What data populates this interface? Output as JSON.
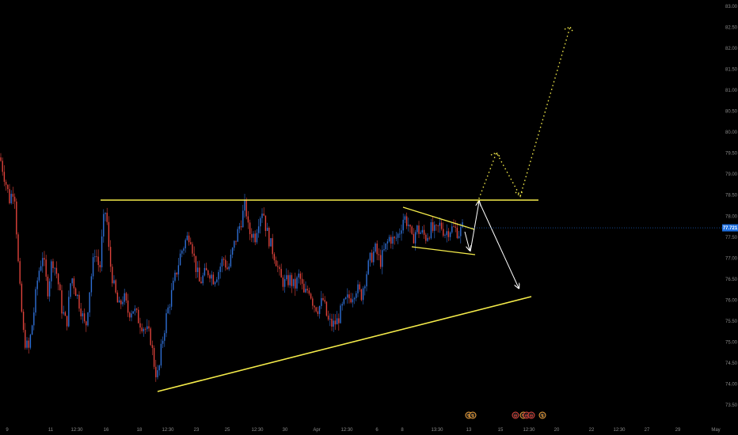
{
  "chart_data": {
    "type": "candlestick",
    "y_axis": {
      "position": "right",
      "range": [
        73.25,
        83.1
      ],
      "ticks": [
        "83.00",
        "82.50",
        "82.00",
        "81.50",
        "81.00",
        "80.50",
        "80.00",
        "79.50",
        "79.00",
        "78.50",
        "78.00",
        "77.50",
        "77.00",
        "76.50",
        "76.00",
        "75.50",
        "75.00",
        "74.50",
        "74.00",
        "73.50"
      ]
    },
    "x_axis": {
      "ticks": [
        "9",
        "11",
        "12:30",
        "16",
        "18",
        "12:30",
        "23",
        "25",
        "12:30",
        "30",
        "Apr",
        "12:30",
        "6",
        "8",
        "13:30",
        "13",
        "15",
        "12:30",
        "20",
        "22",
        "12:30",
        "27",
        "29",
        "May"
      ]
    },
    "last_price": "77.721",
    "colors": {
      "background": "#000000",
      "up_candle": "#2f6fd6",
      "down_candle": "#e0433b",
      "annotation_yellow": "#f5ec4a",
      "arrow_white": "#ffffff",
      "price_tag": "#1e6fe0"
    },
    "ohlc_path": [
      [
        0,
        79.4
      ],
      [
        5,
        79.0
      ],
      [
        12,
        78.4
      ],
      [
        18,
        78.7
      ],
      [
        24,
        76.5
      ],
      [
        30,
        75.1
      ],
      [
        36,
        74.8
      ],
      [
        42,
        75.6
      ],
      [
        48,
        76.6
      ],
      [
        54,
        77.1
      ],
      [
        60,
        76.2
      ],
      [
        66,
        77.0
      ],
      [
        72,
        76.6
      ],
      [
        78,
        75.8
      ],
      [
        84,
        75.4
      ],
      [
        90,
        76.6
      ],
      [
        96,
        76.2
      ],
      [
        102,
        75.8
      ],
      [
        108,
        75.3
      ],
      [
        114,
        76.4
      ],
      [
        120,
        77.2
      ],
      [
        126,
        76.7
      ],
      [
        130,
        77.8
      ],
      [
        134,
        78.2
      ],
      [
        138,
        77.0
      ],
      [
        144,
        76.3
      ],
      [
        150,
        75.8
      ],
      [
        156,
        76.1
      ],
      [
        162,
        75.7
      ],
      [
        168,
        75.8
      ],
      [
        176,
        75.5
      ],
      [
        184,
        75.3
      ],
      [
        190,
        75.1
      ],
      [
        196,
        74.3
      ],
      [
        200,
        74.2
      ],
      [
        204,
        74.9
      ],
      [
        210,
        75.6
      ],
      [
        216,
        76.1
      ],
      [
        222,
        76.6
      ],
      [
        228,
        77.1
      ],
      [
        234,
        77.4
      ],
      [
        240,
        77.6
      ],
      [
        246,
        76.9
      ],
      [
        252,
        76.4
      ],
      [
        258,
        76.6
      ],
      [
        264,
        76.7
      ],
      [
        270,
        76.5
      ],
      [
        276,
        76.7
      ],
      [
        282,
        77.0
      ],
      [
        288,
        76.7
      ],
      [
        294,
        77.2
      ],
      [
        300,
        77.6
      ],
      [
        306,
        78.0
      ],
      [
        310,
        78.3
      ],
      [
        314,
        77.6
      ],
      [
        318,
        77.6
      ],
      [
        322,
        77.5
      ],
      [
        326,
        77.9
      ],
      [
        332,
        78.2
      ],
      [
        336,
        77.7
      ],
      [
        342,
        77.3
      ],
      [
        348,
        77.0
      ],
      [
        354,
        76.5
      ],
      [
        360,
        76.4
      ],
      [
        366,
        76.5
      ],
      [
        372,
        76.3
      ],
      [
        378,
        76.6
      ],
      [
        384,
        76.1
      ],
      [
        390,
        76.3
      ],
      [
        396,
        75.9
      ],
      [
        402,
        75.8
      ],
      [
        408,
        76.0
      ],
      [
        414,
        75.5
      ],
      [
        420,
        75.4
      ],
      [
        426,
        75.5
      ],
      [
        432,
        75.8
      ],
      [
        438,
        76.0
      ],
      [
        444,
        76.1
      ],
      [
        450,
        76.3
      ],
      [
        456,
        76.1
      ],
      [
        462,
        76.6
      ],
      [
        468,
        77.0
      ],
      [
        474,
        77.2
      ],
      [
        480,
        76.9
      ],
      [
        486,
        77.2
      ],
      [
        492,
        77.5
      ],
      [
        498,
        77.4
      ],
      [
        504,
        77.6
      ],
      [
        510,
        78.0
      ],
      [
        516,
        77.8
      ],
      [
        520,
        77.4
      ],
      [
        526,
        77.7
      ],
      [
        532,
        77.6
      ],
      [
        538,
        77.5
      ],
      [
        544,
        77.7
      ],
      [
        550,
        77.6
      ],
      [
        556,
        77.8
      ],
      [
        562,
        77.6
      ],
      [
        568,
        77.7
      ],
      [
        574,
        77.7
      ],
      [
        580,
        77.6
      ],
      [
        584,
        77.72
      ]
    ],
    "events": [
      "↯",
      "↯",
      "⊖",
      "↯",
      "⊖",
      "⊖",
      "↯"
    ]
  }
}
